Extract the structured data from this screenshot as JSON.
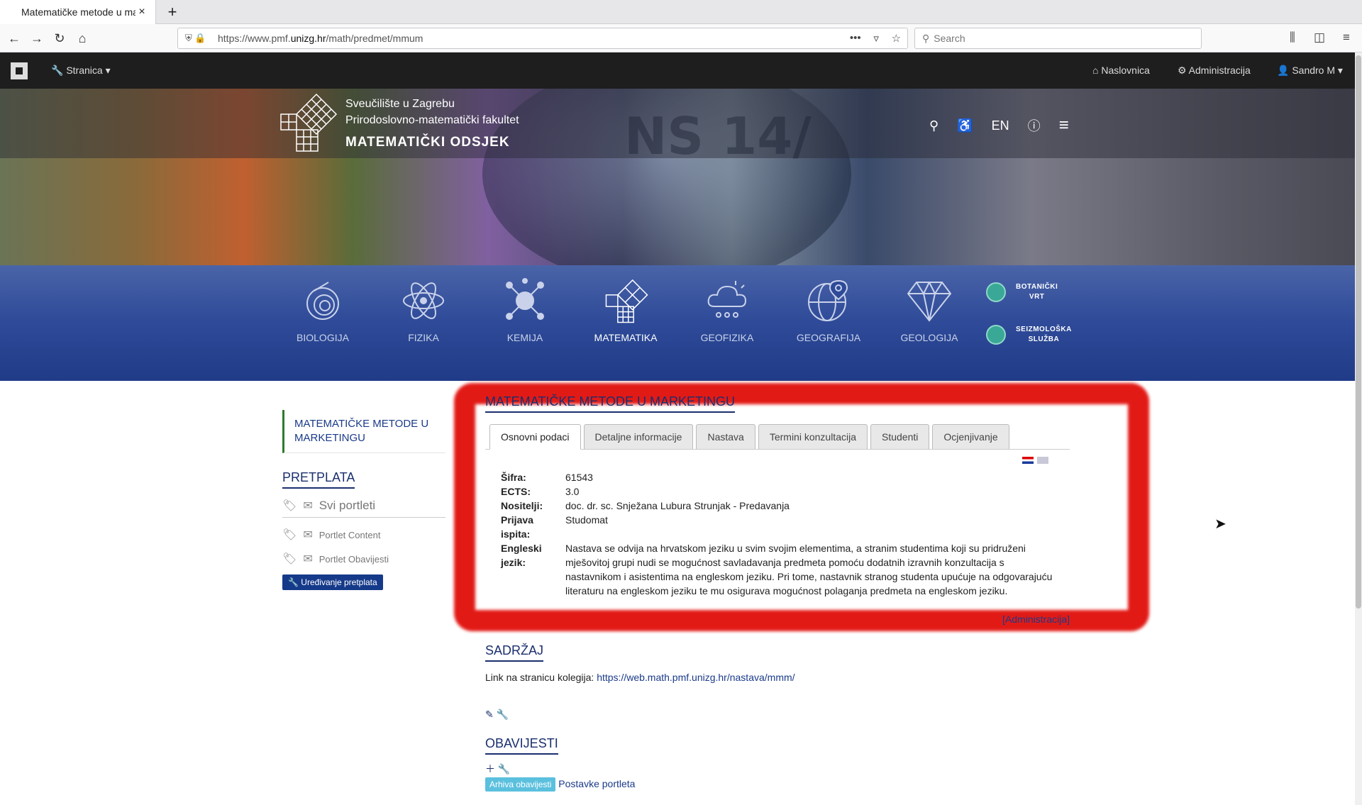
{
  "browser": {
    "tab_title": "Matematičke metode u marketingu",
    "new_tab": "+",
    "url_prefix": "https://www.pmf.",
    "url_domain": "unizg.hr",
    "url_path": "/math/predmet/mmum",
    "search_placeholder": "Search"
  },
  "sitebar": {
    "page_menu": "Stranica",
    "home": "Naslovnica",
    "admin": "Administracija",
    "user": "Sandro M"
  },
  "header": {
    "university": "Sveučilište u Zagrebu",
    "faculty": "Prirodoslovno-matematički fakultet",
    "department": "MATEMATIČKI ODSJEK",
    "stamp_text": "NS 14/",
    "lang": "EN"
  },
  "categories": [
    {
      "label": "BIOLOGIJA",
      "icon": "shell-icon"
    },
    {
      "label": "FIZIKA",
      "icon": "atom-icon"
    },
    {
      "label": "KEMIJA",
      "icon": "molecule-icon"
    },
    {
      "label": "MATEMATIKA",
      "icon": "pythagoras-icon"
    },
    {
      "label": "GEOFIZIKA",
      "icon": "cloud-rain-icon"
    },
    {
      "label": "GEOGRAFIJA",
      "icon": "globe-pin-icon"
    },
    {
      "label": "GEOLOGIJA",
      "icon": "diamond-icon"
    }
  ],
  "side_links": [
    {
      "line1": "BOTANIČKI",
      "line2": "VRT"
    },
    {
      "line1": "SEIZMOLOŠKA",
      "line2": "SLUŽBA"
    }
  ],
  "sidebar": {
    "current": "MATEMATIČKE METODE U MARKETINGU",
    "pretplata_title": "PRETPLATA",
    "all_portlets": "Svi portleti",
    "portlet_content": "Portlet Content",
    "portlet_news": "Portlet Obavijesti",
    "edit_subscription": "Uređivanje pretplata"
  },
  "main": {
    "title": "MATEMATIČKE METODE U MARKETINGU",
    "tabs": [
      "Osnovni podaci",
      "Detaljne informacije",
      "Nastava",
      "Termini konzultacija",
      "Studenti",
      "Ocjenjivanje"
    ],
    "fields": [
      {
        "key": "Šifra:",
        "value": "61543"
      },
      {
        "key": "ECTS:",
        "value": "3.0"
      },
      {
        "key": "Nositelji:",
        "value": "doc. dr. sc. Snježana Lubura Strunjak - Predavanja"
      },
      {
        "key": "Prijava ispita:",
        "value": "Studomat"
      },
      {
        "key": "Engleski jezik:",
        "value": "Nastava se odvija na hrvatskom jeziku u svim svojim elementima, a stranim studentima koji su pridruženi mješovitoj grupi nudi se mogućnost savladavanja predmeta pomoću dodatnih izravnih konzultacija s nastavnikom i asistentima na engleskom jeziku. Pri tome, nastavnik stranog studenta upućuje na odgovarajuću literaturu na engleskom jeziku te mu osigurava mogućnost polaganja predmeta na engleskom jeziku."
      }
    ],
    "admin_link": "[Administracija]",
    "content_title": "SADRŽAJ",
    "content_link_label": "Link na stranicu kolegija:",
    "content_link": "https://web.math.pmf.unizg.hr/nastava/mmm/",
    "news_title": "OBAVIJESTI",
    "archive_button": "Arhiva obavijesti",
    "portlet_settings": "Postavke portleta"
  },
  "colors": {
    "accent_navy": "#1a2f6e",
    "highlight_red": "#e21a16",
    "category_blue": "#2e4a98"
  }
}
